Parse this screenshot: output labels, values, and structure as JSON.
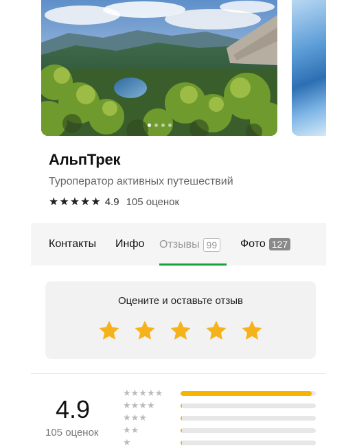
{
  "gallery": {
    "photo_count_dots": 4,
    "active_dot": 0
  },
  "company": {
    "name": "АльпТрек",
    "subtitle": "Туроператор активных путешествий",
    "rating": "4.9",
    "rating_stars": 5,
    "reviews_count": "105 оценок"
  },
  "tabs": [
    {
      "label": "Контакты"
    },
    {
      "label": "Инфо"
    },
    {
      "label": "Отзывы",
      "badge": "99",
      "active": true
    },
    {
      "label": "Фото",
      "badge": "127"
    }
  ],
  "rate_card": {
    "title": "Оцените и оставьте отзыв",
    "star_color": "#f6b21b"
  },
  "summary": {
    "rating": "4.9",
    "count": "105 оценок",
    "distribution": [
      {
        "stars": 5,
        "fraction": 0.97
      },
      {
        "stars": 4,
        "fraction": 0.01
      },
      {
        "stars": 3,
        "fraction": 0.01
      },
      {
        "stars": 2,
        "fraction": 0.01
      },
      {
        "stars": 1,
        "fraction": 0.01
      }
    ],
    "bar_color": "#f4b400"
  },
  "colors": {
    "accent_green": "#1aa03a",
    "tab_bg": "#f5f5f5"
  }
}
